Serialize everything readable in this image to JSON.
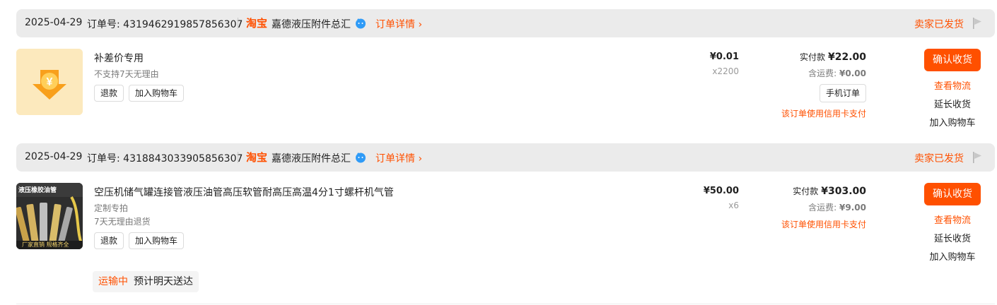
{
  "orders": [
    {
      "date": "2025-04-29",
      "order_no": "订单号: 4319462919857856307",
      "platform": "淘宝",
      "shop": "嘉德液压附件总汇",
      "detail_link": "订单详情 ›",
      "status": "卖家已发货",
      "item": {
        "title": "补差价专用",
        "tags": [
          "不支持7天无理由"
        ],
        "refund": "退款",
        "add_cart": "加入购物车",
        "unit_price": "¥0.01",
        "quantity": "x2200"
      },
      "paid_label": "实付款",
      "paid_amount": "¥22.00",
      "shipping_label": "含运费:",
      "shipping_amount": "¥0.00",
      "mobile_order": "手机订单",
      "credit_note": "该订单使用信用卡支付",
      "actions": {
        "confirm": "确认收货",
        "logistics": "查看物流",
        "extend": "延长收货",
        "add_cart": "加入购物车"
      }
    },
    {
      "date": "2025-04-29",
      "order_no": "订单号: 4318843033905856307",
      "platform": "淘宝",
      "shop": "嘉德液压附件总汇",
      "detail_link": "订单详情 ›",
      "status": "卖家已发货",
      "item": {
        "title": "空压机储气罐连接管液压油管高压软管耐高压高温4分1寸螺杆机气管",
        "tags": [
          "定制专拍",
          "7天无理由退货"
        ],
        "refund": "退款",
        "add_cart": "加入购物车",
        "unit_price": "¥50.00",
        "quantity": "x6",
        "image_text_top": "液压橡胶油管",
        "image_text_bottom": "厂家直销  规格齐全"
      },
      "paid_label": "实付款",
      "paid_amount": "¥303.00",
      "shipping_label": "含运费:",
      "shipping_amount": "¥9.00",
      "credit_note": "该订单使用信用卡支付",
      "actions": {
        "confirm": "确认收货",
        "logistics": "查看物流",
        "extend": "延长收货",
        "add_cart": "加入购物车"
      },
      "shipping_status": "运输中",
      "delivery_estimate": "预计明天送达"
    }
  ],
  "colors": {
    "accent": "#ff5000",
    "header_bg": "#ebebeb",
    "wangwang_blue": "#2f9bf7",
    "coin_yellow": "#f8a01c"
  }
}
